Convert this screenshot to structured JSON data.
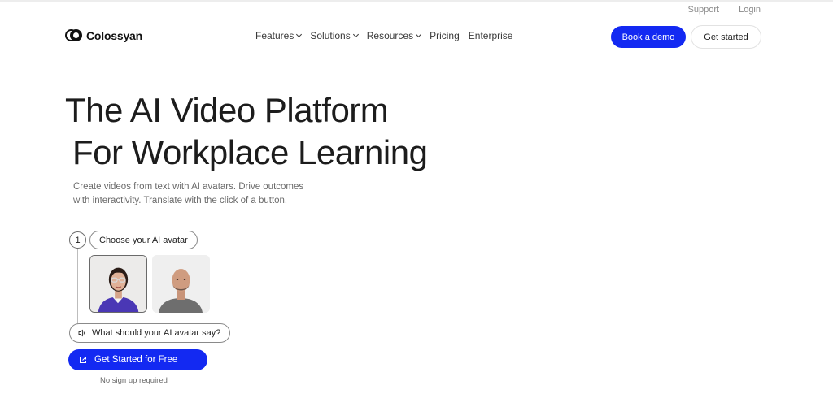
{
  "utility": {
    "support": "Support",
    "login": "Login"
  },
  "brand": {
    "name": "Colossyan"
  },
  "nav": {
    "items": [
      {
        "label": "Features",
        "dropdown": true
      },
      {
        "label": "Solutions",
        "dropdown": true
      },
      {
        "label": "Resources",
        "dropdown": true
      },
      {
        "label": "Pricing",
        "dropdown": false
      },
      {
        "label": "Enterprise",
        "dropdown": false
      }
    ]
  },
  "header": {
    "book_demo": "Book a demo",
    "get_started": "Get started"
  },
  "hero": {
    "title_line1": "The AI Video Platform",
    "title_line2": "For Workplace Learning",
    "subtitle": "Create videos from text with AI avatars. Drive outcomes with interactivity. Translate with the click of a button."
  },
  "builder": {
    "step_number": "1",
    "step_label": "Choose your AI avatar",
    "prompt_label": "What should your AI avatar say?",
    "prompt_icon": "speaker-icon",
    "cta_label": "Get Started for Free",
    "cta_icon": "external-link-icon",
    "cta_note": "No sign up required"
  },
  "colors": {
    "accent": "#1329f2",
    "text": "#1c1c1c",
    "muted": "#6b6b6b"
  }
}
